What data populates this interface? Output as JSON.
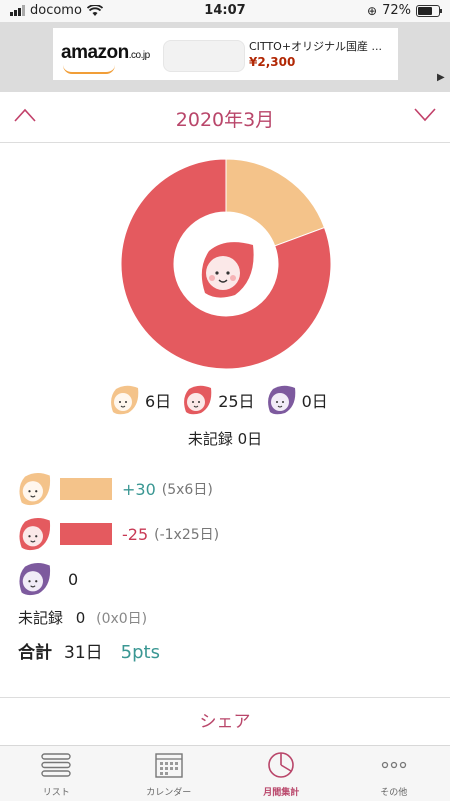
{
  "status_bar": {
    "carrier": "docomo",
    "time": "14:07",
    "battery": "72%",
    "battery_level": 0.72
  },
  "ad": {
    "brand": "amazon",
    "brand_suffix": ".co.jp",
    "title": "CITTO+オリジナル国産 ...",
    "price": "¥2,300"
  },
  "month_header": {
    "title": "2020年3月",
    "prev_icon": "chevron-up-icon",
    "next_icon": "chevron-down-icon"
  },
  "chart_data": {
    "type": "pie",
    "categories": [
      "good",
      "bad",
      "neutral"
    ],
    "values": [
      6,
      25,
      0
    ],
    "colors": [
      "#f4c38a",
      "#e45a5f",
      "#7d5a9e"
    ]
  },
  "legend": {
    "good_label": "6日",
    "bad_label": "25日",
    "neutral_label": "0日",
    "unrecorded": "未記録 0日"
  },
  "summary": {
    "good_points": "+30",
    "good_calc": "(5x6日)",
    "bad_points": "-25",
    "bad_calc": "(-1x25日)",
    "neutral_points": "0",
    "unrecorded_label": "未記録",
    "unrecorded_value": "0",
    "unrecorded_calc": "(0x0日)",
    "total_label": "合計",
    "total_days": "31日",
    "total_points": "5pts"
  },
  "share_label": "シェア",
  "tabs": [
    {
      "label": "リスト",
      "icon": "list-icon"
    },
    {
      "label": "カレンダー",
      "icon": "calendar-icon"
    },
    {
      "label": "月間集計",
      "icon": "pie-chart-icon"
    },
    {
      "label": "その他",
      "icon": "more-icon"
    }
  ],
  "colors": {
    "accent": "#b9466a",
    "good": "#f4c38a",
    "bad": "#e45a5f",
    "neutral": "#7d5a9e",
    "points_positive": "#3a9793"
  }
}
